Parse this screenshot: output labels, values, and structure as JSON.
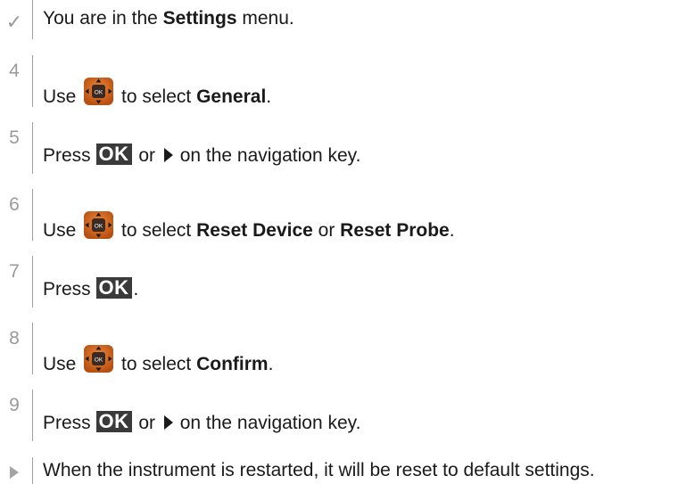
{
  "prereq": {
    "text_before": "You are in the ",
    "bold": "Settings",
    "text_after": " menu."
  },
  "steps": [
    {
      "num": "4",
      "pre": "Use ",
      "mid": " to select ",
      "bold": "General",
      "post": "."
    },
    {
      "num": "5",
      "pre": "Press ",
      "or": " or ",
      "post": " on the navigation key."
    },
    {
      "num": "6",
      "pre": "Use ",
      "mid": " to select ",
      "bold": "Reset Device",
      "join": " or ",
      "bold2": "Reset Probe",
      "post": "."
    },
    {
      "num": "7",
      "pre": "Press ",
      "post": "."
    },
    {
      "num": "8",
      "pre": "Use ",
      "mid": " to select ",
      "bold": "Confirm",
      "post": "."
    },
    {
      "num": "9",
      "pre": "Press ",
      "or": " or ",
      "post": " on the navigation key."
    }
  ],
  "result": {
    "text": "When the instrument is restarted, it will be reset to default settings."
  },
  "key": {
    "ok_label": "OK",
    "navkey_label": "OK"
  },
  "colors": {
    "navkey_orange": "#d9661c",
    "navkey_dark": "#8a3d0c",
    "ok_bg": "#3a3a3a",
    "marker_gray": "#9a9a9a"
  },
  "icons": {
    "prereq": "check-icon",
    "result": "result-arrow-icon",
    "navkey": "navigation-key-icon",
    "ok": "ok-key-icon",
    "right": "right-arrow-icon"
  }
}
